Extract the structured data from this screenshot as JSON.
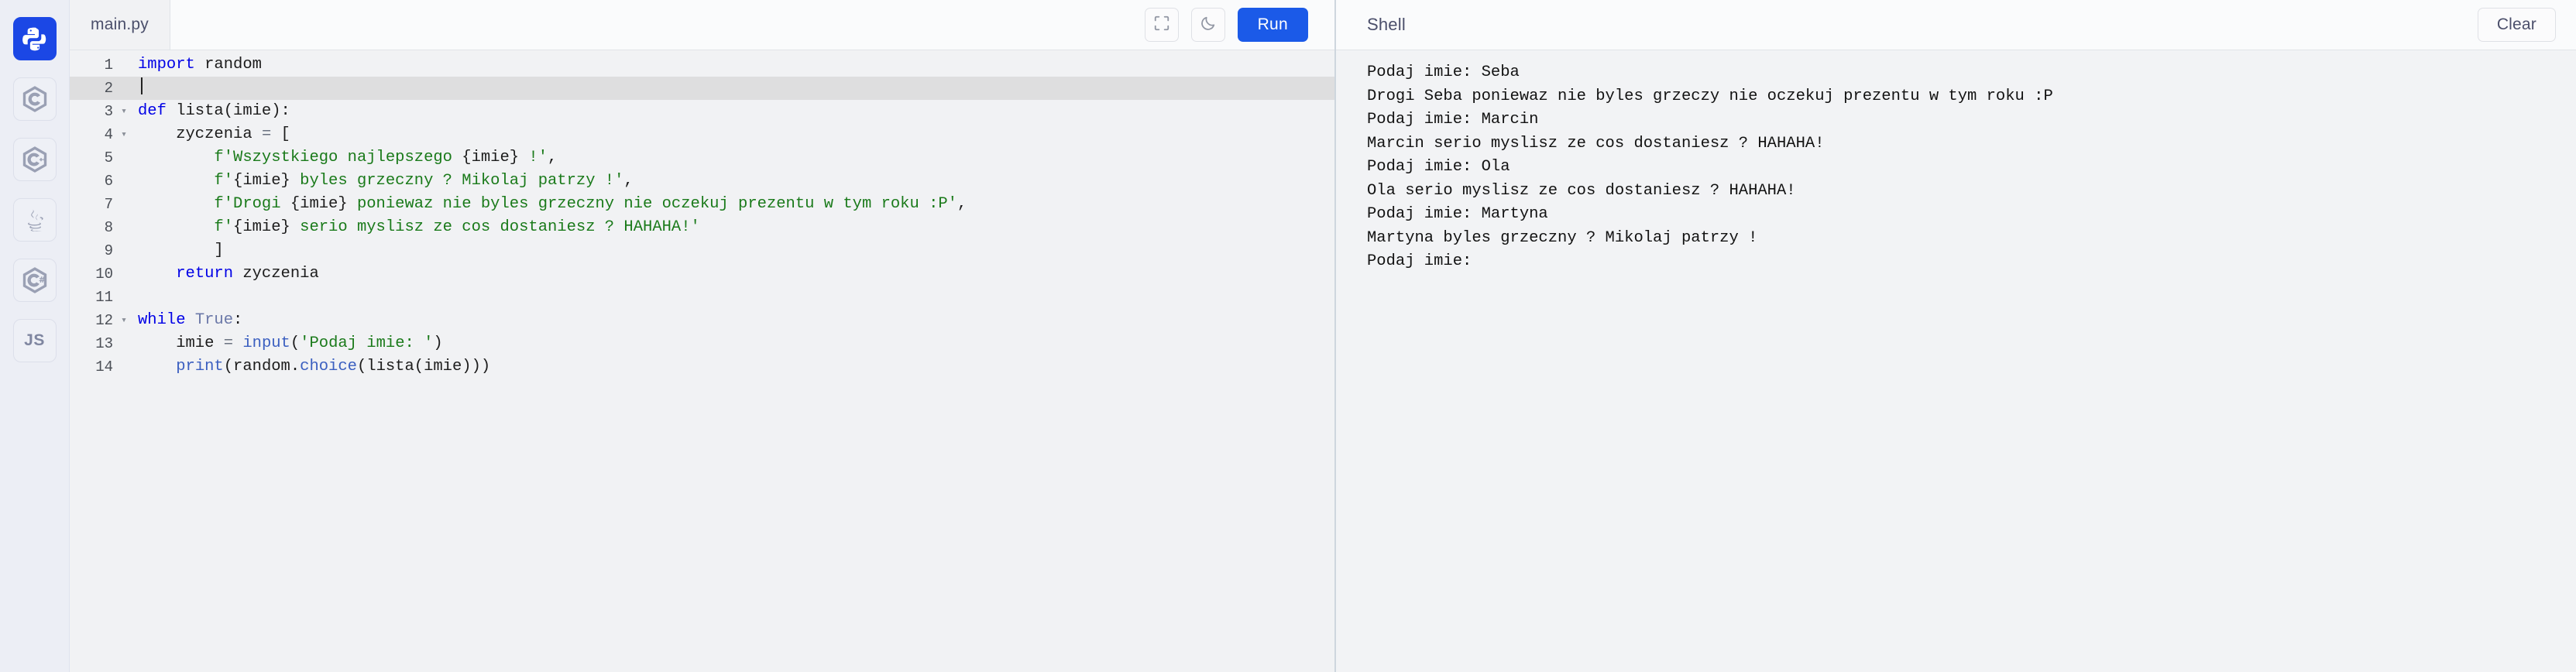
{
  "sidebar": {
    "items": [
      {
        "name": "python",
        "label": "Python",
        "icon": "python-icon",
        "active": true
      },
      {
        "name": "c",
        "label": "C",
        "icon": "c-hex-icon",
        "active": false
      },
      {
        "name": "cpp",
        "label": "C++",
        "icon": "cpp-hex-icon",
        "active": false
      },
      {
        "name": "java",
        "label": "Java",
        "icon": "java-coffee-icon",
        "active": false
      },
      {
        "name": "csharp",
        "label": "C#",
        "icon": "csharp-hex-icon",
        "active": false
      },
      {
        "name": "js",
        "label": "JS",
        "icon": "js-text-icon",
        "active": false
      }
    ]
  },
  "editor": {
    "tabs": [
      {
        "label": "main.py",
        "active": true
      }
    ],
    "toolbar": {
      "fullscreen_icon": "fullscreen-icon",
      "theme_icon": "moon-icon",
      "run_label": "Run",
      "run_color": "#1b5ae8"
    },
    "active_line": 2,
    "fold_lines": [
      3,
      4,
      12
    ],
    "lines": [
      {
        "n": 1,
        "tokens": [
          {
            "t": "import",
            "c": "k"
          },
          {
            "t": " random",
            "c": ""
          }
        ]
      },
      {
        "n": 2,
        "tokens": []
      },
      {
        "n": 3,
        "tokens": [
          {
            "t": "def",
            "c": "k"
          },
          {
            "t": " lista(imie):",
            "c": ""
          }
        ]
      },
      {
        "n": 4,
        "tokens": [
          {
            "t": "    zyczenia ",
            "c": ""
          },
          {
            "t": "=",
            "c": "op"
          },
          {
            "t": " [",
            "c": ""
          }
        ]
      },
      {
        "n": 5,
        "tokens": [
          {
            "t": "        ",
            "c": ""
          },
          {
            "t": "f'Wszystkiego najlepszego ",
            "c": "s"
          },
          {
            "t": "{imie}",
            "c": "fp"
          },
          {
            "t": " !'",
            "c": "s"
          },
          {
            "t": ",",
            "c": ""
          }
        ]
      },
      {
        "n": 6,
        "tokens": [
          {
            "t": "        ",
            "c": ""
          },
          {
            "t": "f'",
            "c": "s"
          },
          {
            "t": "{imie}",
            "c": "fp"
          },
          {
            "t": " byles grzeczny ? Mikolaj patrzy !'",
            "c": "s"
          },
          {
            "t": ",",
            "c": ""
          }
        ]
      },
      {
        "n": 7,
        "tokens": [
          {
            "t": "        ",
            "c": ""
          },
          {
            "t": "f'Drogi ",
            "c": "s"
          },
          {
            "t": "{imie}",
            "c": "fp"
          },
          {
            "t": " poniewaz nie byles grzeczny nie oczekuj prezentu w tym roku :P'",
            "c": "s"
          },
          {
            "t": ",",
            "c": ""
          }
        ]
      },
      {
        "n": 8,
        "tokens": [
          {
            "t": "        ",
            "c": ""
          },
          {
            "t": "f'",
            "c": "s"
          },
          {
            "t": "{imie}",
            "c": "fp"
          },
          {
            "t": " serio myslisz ze cos dostaniesz ? HAHAHA!'",
            "c": "s"
          }
        ]
      },
      {
        "n": 9,
        "tokens": [
          {
            "t": "        ]",
            "c": ""
          }
        ]
      },
      {
        "n": 10,
        "tokens": [
          {
            "t": "    ",
            "c": ""
          },
          {
            "t": "return",
            "c": "k"
          },
          {
            "t": " zyczenia",
            "c": ""
          }
        ]
      },
      {
        "n": 11,
        "tokens": []
      },
      {
        "n": 12,
        "tokens": [
          {
            "t": "while",
            "c": "k"
          },
          {
            "t": " ",
            "c": ""
          },
          {
            "t": "True",
            "c": "cn"
          },
          {
            "t": ":",
            "c": ""
          }
        ]
      },
      {
        "n": 13,
        "tokens": [
          {
            "t": "    imie ",
            "c": ""
          },
          {
            "t": "=",
            "c": "op"
          },
          {
            "t": " ",
            "c": ""
          },
          {
            "t": "input",
            "c": "bi"
          },
          {
            "t": "(",
            "c": ""
          },
          {
            "t": "'Podaj imie: '",
            "c": "s"
          },
          {
            "t": ")",
            "c": ""
          }
        ]
      },
      {
        "n": 14,
        "tokens": [
          {
            "t": "    ",
            "c": ""
          },
          {
            "t": "print",
            "c": "bi"
          },
          {
            "t": "(random.",
            "c": ""
          },
          {
            "t": "choice",
            "c": "bi"
          },
          {
            "t": "(lista(imie)))",
            "c": ""
          }
        ]
      }
    ]
  },
  "shell": {
    "title": "Shell",
    "clear_label": "Clear",
    "output_lines": [
      "Podaj imie: Seba",
      "Drogi Seba poniewaz nie byles grzeczy nie oczekuj prezentu w tym roku :P",
      "Podaj imie: Marcin",
      "Marcin serio myslisz ze cos dostaniesz ? HAHAHA!",
      "Podaj imie: Ola",
      "Ola serio myslisz ze cos dostaniesz ? HAHAHA!",
      "Podaj imie: Martyna",
      "Martyna byles grzeczny ? Mikolaj patrzy !",
      "Podaj imie:"
    ]
  },
  "theme": {
    "accent": "#1b5ae8",
    "sidebar_bg": "#eceef5",
    "editor_bg": "#f1f2f4",
    "shell_bg": "#f2f3f5",
    "keyword": "#0000e6",
    "string": "#1a7a1a"
  }
}
